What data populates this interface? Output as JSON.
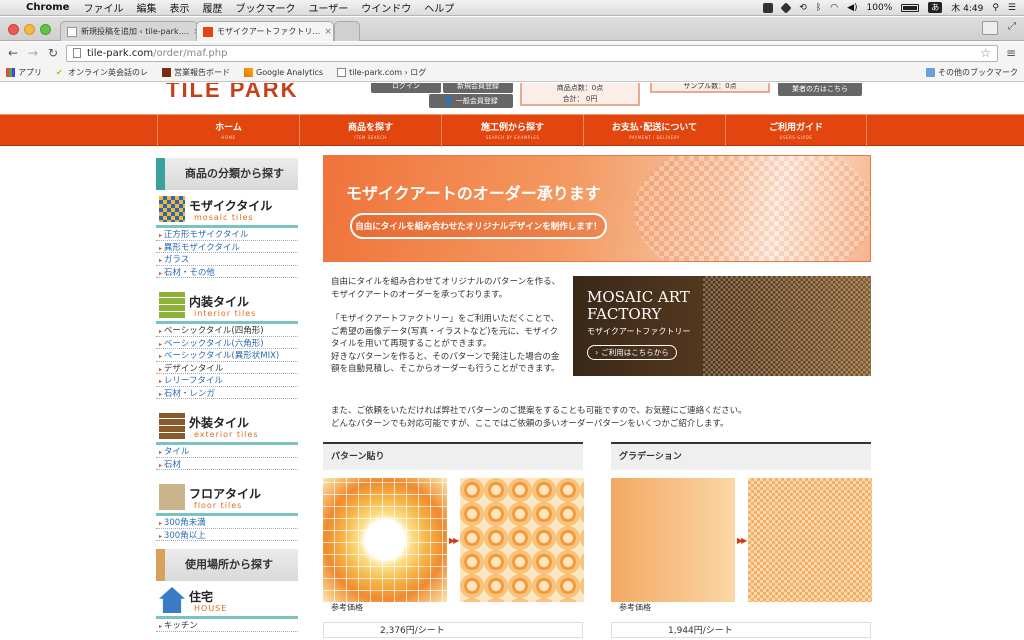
{
  "menubar": {
    "app": "Chrome",
    "items": [
      "ファイル",
      "編集",
      "表示",
      "履歴",
      "ブックマーク",
      "ユーザー",
      "ウインドウ",
      "ヘルプ"
    ],
    "battery": "100%",
    "input_method": "あ",
    "clock": "木 4:49"
  },
  "tabs": [
    {
      "title": "新規投稿を追加 ‹ tile-park.…",
      "active": false
    },
    {
      "title": "モザイクアートファクトリ…",
      "active": true
    }
  ],
  "toolbar": {
    "url_host": "tile-park.com",
    "url_path": "/order/maf.php"
  },
  "bookmarks": {
    "items": [
      "アプリ",
      "オンライン英会話のレ",
      "営業報告ボード",
      "Google Analytics",
      "tile-park.com › ログ"
    ],
    "other": "その他のブックマーク"
  },
  "header": {
    "logo_text": "TILE PARK",
    "login_button": "ログイン",
    "register_button": "新規会員登録",
    "member_button": "一般会員登録",
    "cart_count": "商品点数：0点",
    "cart_total": "合計： 0円",
    "sample_count": "サンプル数：0点",
    "business_button": "業者の方はこちら"
  },
  "global_nav": [
    {
      "label": "ホーム",
      "sub": "HOME"
    },
    {
      "label": "商品を探す",
      "sub": "ITEM SEARCH"
    },
    {
      "label": "施工例から探す",
      "sub": "SEARCH BY EXAMPLES"
    },
    {
      "label": "お支払･配送について",
      "sub": "PAYMENT / DELIVERY"
    },
    {
      "label": "ご利用ガイド",
      "sub": "USERS GUIDE"
    }
  ],
  "sidebar": {
    "heading1": "商品の分類から探す",
    "cats": [
      {
        "title": "モザイクタイル",
        "sub": "mosaic tiles",
        "items": [
          "正方形モザイクタイル",
          "異形モザイクタイル",
          "ガラス",
          "石材・その他"
        ]
      },
      {
        "title": "内装タイル",
        "sub": "interior tiles",
        "items": [
          "ベーシックタイル(四角形)",
          "ベーシックタイル(六角形)",
          "ベーシックタイル(異形状MIX)",
          "デザインタイル",
          "レリーフタイル",
          "石材・レンガ"
        ]
      },
      {
        "title": "外装タイル",
        "sub": "exterior tiles",
        "items": [
          "タイル",
          "石材"
        ]
      },
      {
        "title": "フロアタイル",
        "sub": "floor tiles",
        "items": [
          "300角未満",
          "300角以上"
        ]
      }
    ],
    "heading2": "使用場所から探す",
    "place": {
      "title": "住宅",
      "sub": "HOUSE",
      "items": [
        "キッチン"
      ]
    }
  },
  "banner": {
    "title": "モザイクアートのオーダー承ります",
    "subtitle": "自由にタイルを組み合わせたオリジナルデザインを制作します！"
  },
  "intro": {
    "p1": "自由にタイルを組み合わせてオリジナルのパターンを作る、モザイクアートのオーダーを承っております。",
    "p2": "「モザイクアートファクトリー」をご利用いただくことで、ご希望の画像データ(写真・イラストなど)を元に、モザイクタイルを用いて再現することができます。",
    "p3": "好きなパターンを作ると、そのパターンで発注した場合の金額を自動見積し、そこからオーダーも行うことができます。"
  },
  "factory": {
    "title1": "MOSAIC ART",
    "title2": "FACTORY",
    "subtitle": "モザイクアートファクトリー",
    "button": "ご利用はこちらから"
  },
  "request": {
    "line1": "また、ご依頼をいただければ弊社でパターンのご提案をすることも可能ですので、お気軽にご連絡ください。",
    "line2": "どんなパターンでも対応可能ですが、ここではご依頼の多いオーダーパターンをいくつかご紹介します。"
  },
  "sections": [
    {
      "title": "パターン貼り",
      "ref": "参考価格",
      "price": "2,376円/シート"
    },
    {
      "title": "グラデーション",
      "ref": "参考価格",
      "price": "1,944円/シート"
    }
  ],
  "colors": {
    "brand_orange": "#e2460e",
    "teal": "#39a2a0",
    "link_blue": "#2a6bb4"
  }
}
